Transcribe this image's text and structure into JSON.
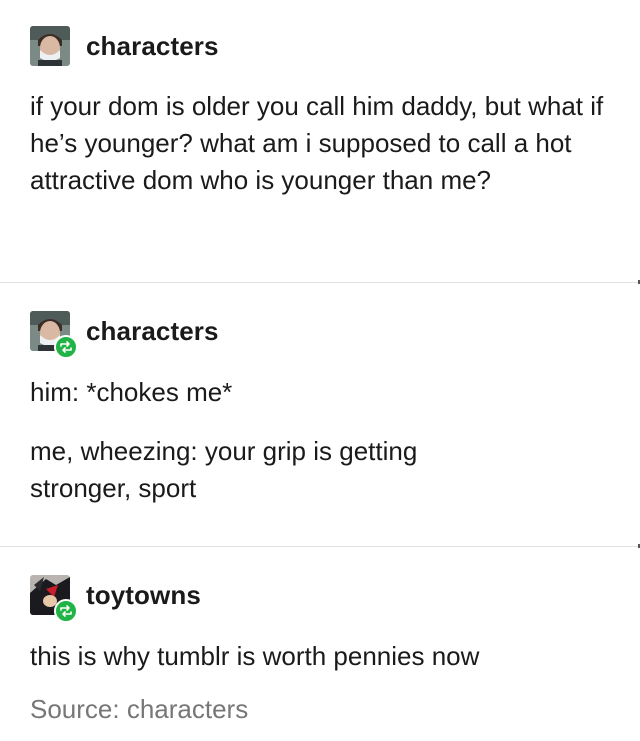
{
  "posts": [
    {
      "username": "characters",
      "reblog": false,
      "paragraphs": [
        "if your dom is older you call him daddy, but what if he’s younger? what am i supposed to call a hot attractive dom who is younger than me?"
      ]
    },
    {
      "username": "characters",
      "reblog": true,
      "paragraphs": [
        "him: *chokes me*",
        "me, wheezing: your grip is getting stronger, sport"
      ]
    },
    {
      "username": "toytowns",
      "reblog": true,
      "paragraphs": [
        "this is why tumblr is worth pennies now"
      ]
    }
  ],
  "source_text": "Source: characters",
  "colors": {
    "reblog_badge": "#21b346",
    "divider": "#e0e0e0",
    "source_text": "#777777"
  },
  "icons": {
    "reblog": "reblog-icon"
  }
}
